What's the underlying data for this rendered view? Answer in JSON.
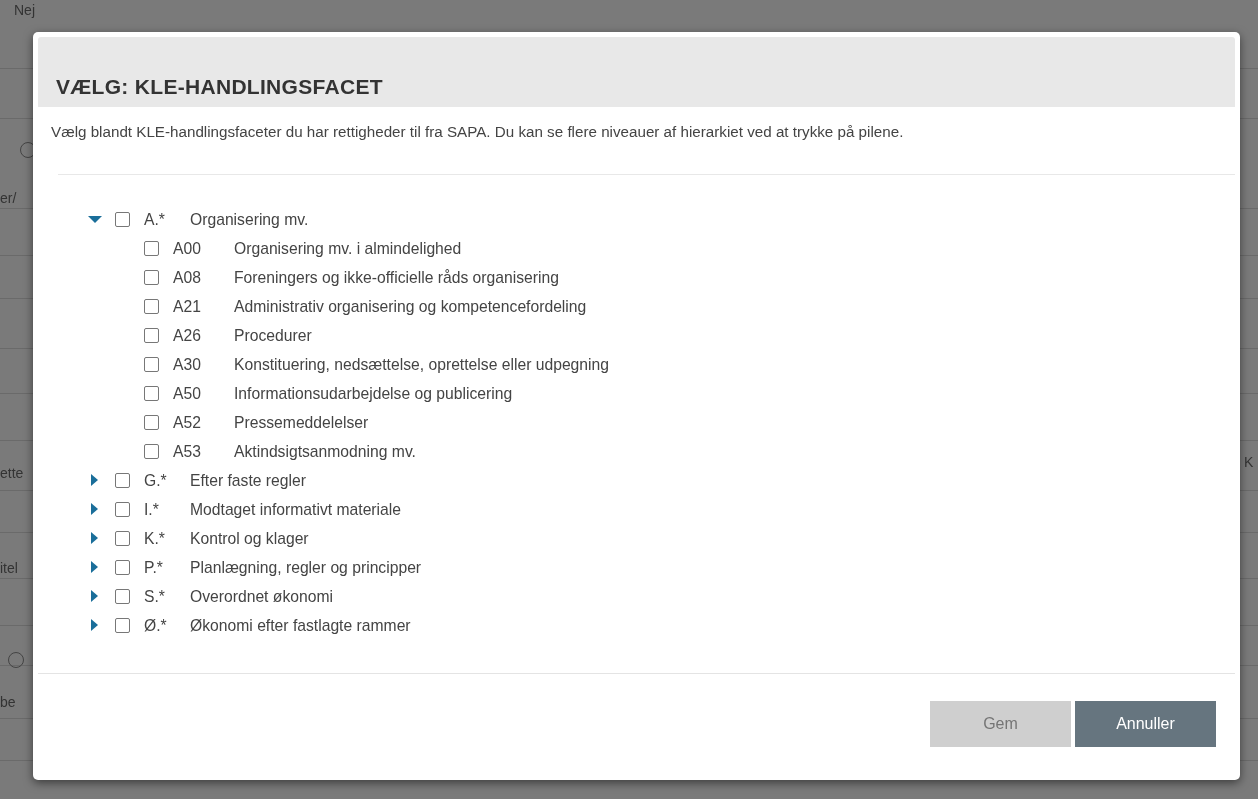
{
  "background": {
    "fragments": [
      {
        "text": "Nej",
        "kind": "text"
      },
      {
        "kind": "radio",
        "selected": false
      },
      {
        "text": "er/",
        "kind": "text"
      },
      {
        "text": "ette",
        "kind": "text"
      },
      {
        "text": "itel",
        "kind": "text"
      },
      {
        "kind": "radio",
        "selected": false
      },
      {
        "text": "be",
        "kind": "text"
      },
      {
        "text": "K",
        "kind": "text"
      }
    ]
  },
  "dialog": {
    "title": "VÆLG: KLE-HANDLINGSFACET",
    "description": "Vælg blandt KLE-handlingsfaceter du har rettigheder til fra SAPA. Du kan se flere niveauer af hierarkiet ved at trykke på pilene.",
    "tree": [
      {
        "code": "A.*",
        "label": "Organisering mv.",
        "expanded": true,
        "checked": false,
        "children": [
          {
            "code": "A00",
            "label": "Organisering mv. i almindelighed",
            "checked": false
          },
          {
            "code": "A08",
            "label": "Foreningers og ikke-officielle råds organisering",
            "checked": false
          },
          {
            "code": "A21",
            "label": "Administrativ organisering og kompetencefordeling",
            "checked": false
          },
          {
            "code": "A26",
            "label": "Procedurer",
            "checked": false
          },
          {
            "code": "A30",
            "label": "Konstituering, nedsættelse, oprettelse eller udpegning",
            "checked": false
          },
          {
            "code": "A50",
            "label": "Informationsudarbejdelse og publicering",
            "checked": false
          },
          {
            "code": "A52",
            "label": "Pressemeddelelser",
            "checked": false
          },
          {
            "code": "A53",
            "label": "Aktindsigtsanmodning mv.",
            "checked": false
          }
        ]
      },
      {
        "code": "G.*",
        "label": "Efter faste regler",
        "expanded": false,
        "checked": false
      },
      {
        "code": "I.*",
        "label": "Modtaget informativt materiale",
        "expanded": false,
        "checked": false
      },
      {
        "code": "K.*",
        "label": "Kontrol og klager",
        "expanded": false,
        "checked": false
      },
      {
        "code": "P.*",
        "label": "Planlægning, regler og principper",
        "expanded": false,
        "checked": false
      },
      {
        "code": "S.*",
        "label": "Overordnet økonomi",
        "expanded": false,
        "checked": false
      },
      {
        "code": "Ø.*",
        "label": "Økonomi efter fastlagte rammer",
        "expanded": false,
        "checked": false
      }
    ],
    "buttons": [
      {
        "label": "Gem",
        "disabled": true
      },
      {
        "label": "Annuller",
        "disabled": false
      }
    ]
  }
}
